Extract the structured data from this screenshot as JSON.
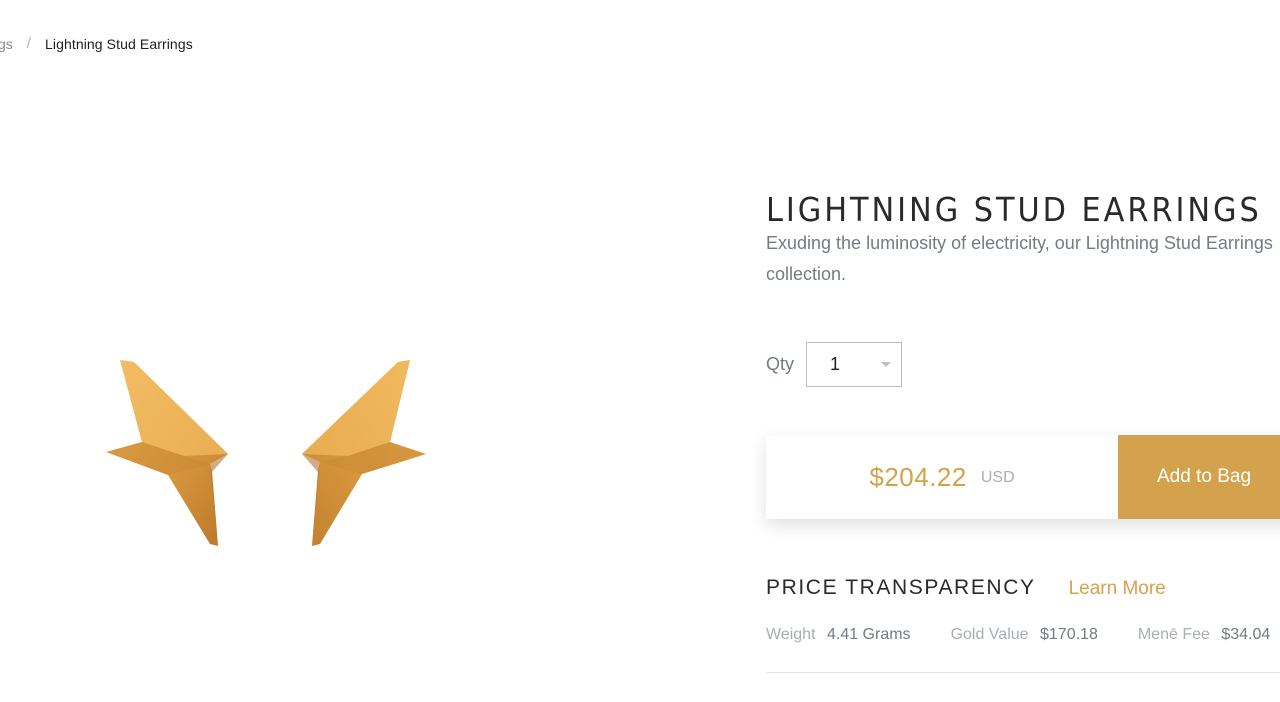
{
  "breadcrumb": {
    "previous": "gs",
    "separator": "/",
    "current": "Lightning Stud Earrings"
  },
  "product": {
    "title": "LIGHTNING STUD EARRINGS",
    "description": "Exuding the luminosity of electricity, our Lightning Stud Earrings collection.",
    "description_line1": "Exuding the luminosity of electricity, our Lightning Stud Earrings",
    "description_line2": "collection.",
    "image_alt": "gold lightning bolt stud earrings"
  },
  "qty": {
    "label": "Qty",
    "value": "1"
  },
  "purchase": {
    "price": "$204.22",
    "currency": "USD",
    "add_to_bag": "Add to Bag"
  },
  "transparency": {
    "heading": "PRICE TRANSPARENCY",
    "learn_more": "Learn More",
    "stats": [
      {
        "label": "Weight",
        "value": "4.41 Grams"
      },
      {
        "label": "Gold Value",
        "value": "$170.18"
      },
      {
        "label": "Menē Fee",
        "value": "$34.04"
      }
    ]
  },
  "colors": {
    "gold_accent": "#d4a24c",
    "muted_text": "#737b84",
    "light_text": "#a9aeb4"
  }
}
